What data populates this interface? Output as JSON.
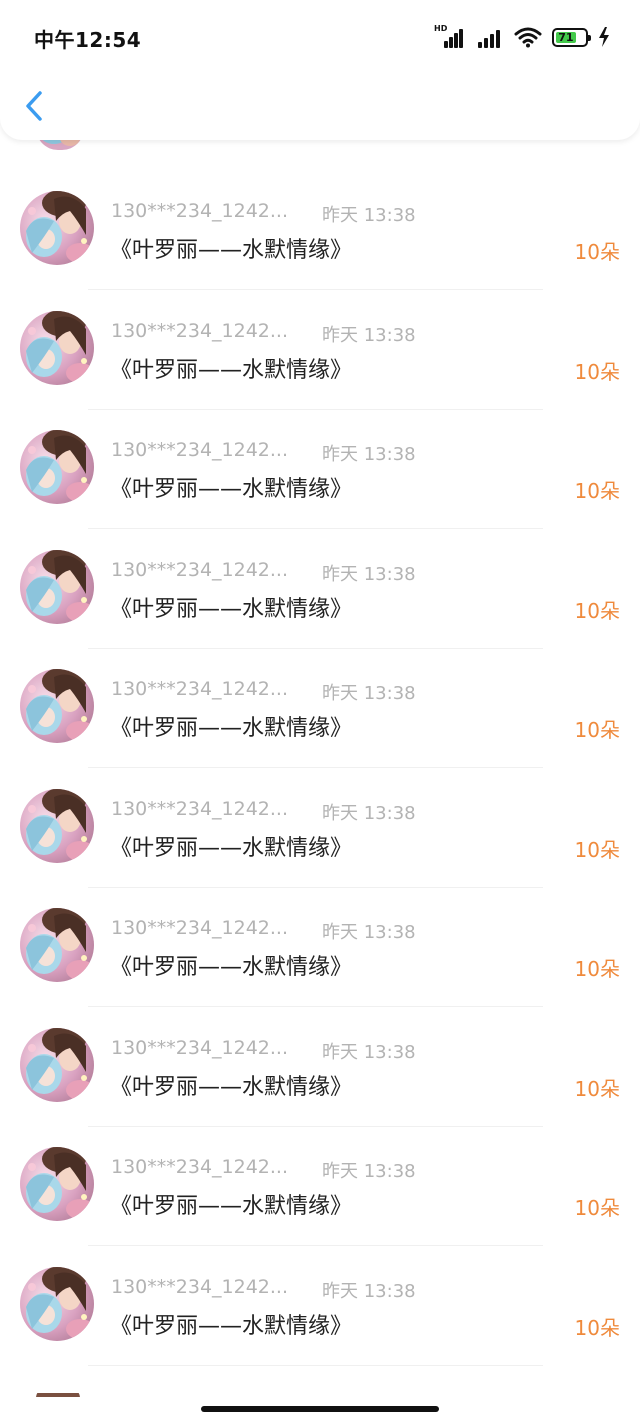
{
  "status_bar": {
    "time": "中午12:54",
    "network_badge": "HD",
    "battery_level": "71",
    "icons": [
      "cellular-signal-icon",
      "cellular-signal-icon",
      "wifi-icon",
      "battery-icon",
      "charging-icon"
    ]
  },
  "header": {
    "back_icon": "chevron-left-icon"
  },
  "colors": {
    "accent_blue": "#3b9cf0",
    "amount_orange": "#ef8a3c",
    "secondary_gray": "#b3b3b3",
    "title_dark": "#222222",
    "battery_green": "#43c94b"
  },
  "gifts": [
    {
      "user": "130***234_1242...",
      "time": "昨天 13:38",
      "title": "《叶罗丽——水默情缘》",
      "amount": "10朵"
    },
    {
      "user": "130***234_1242...",
      "time": "昨天 13:38",
      "title": "《叶罗丽——水默情缘》",
      "amount": "10朵"
    },
    {
      "user": "130***234_1242...",
      "time": "昨天 13:38",
      "title": "《叶罗丽——水默情缘》",
      "amount": "10朵"
    },
    {
      "user": "130***234_1242...",
      "time": "昨天 13:38",
      "title": "《叶罗丽——水默情缘》",
      "amount": "10朵"
    },
    {
      "user": "130***234_1242...",
      "time": "昨天 13:38",
      "title": "《叶罗丽——水默情缘》",
      "amount": "10朵"
    },
    {
      "user": "130***234_1242...",
      "time": "昨天 13:38",
      "title": "《叶罗丽——水默情缘》",
      "amount": "10朵"
    },
    {
      "user": "130***234_1242...",
      "time": "昨天 13:38",
      "title": "《叶罗丽——水默情缘》",
      "amount": "10朵"
    },
    {
      "user": "130***234_1242...",
      "time": "昨天 13:38",
      "title": "《叶罗丽——水默情缘》",
      "amount": "10朵"
    },
    {
      "user": "130***234_1242...",
      "time": "昨天 13:38",
      "title": "《叶罗丽——水默情缘》",
      "amount": "10朵"
    },
    {
      "user": "130***234_1242...",
      "time": "昨天 13:38",
      "title": "《叶罗丽——水默情缘》",
      "amount": "10朵"
    }
  ]
}
